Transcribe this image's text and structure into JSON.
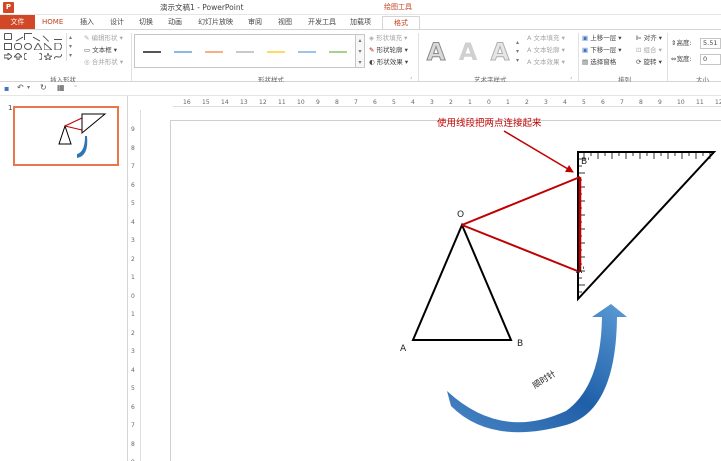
{
  "window": {
    "app_icon": "P",
    "title": "演示文稿1 - PowerPoint",
    "context_tab_group": "绘图工具"
  },
  "tabs": [
    {
      "label": "文件"
    },
    {
      "label": "HOME"
    },
    {
      "label": "插入"
    },
    {
      "label": "设计"
    },
    {
      "label": "切换"
    },
    {
      "label": "动画"
    },
    {
      "label": "幻灯片放映"
    },
    {
      "label": "审阅"
    },
    {
      "label": "视图"
    },
    {
      "label": "开发工具"
    },
    {
      "label": "加载项"
    },
    {
      "label": "格式"
    }
  ],
  "ribbon": {
    "insert_shapes": {
      "label": "插入形状",
      "edit_shape": "编辑形状",
      "text_box": "文本框",
      "merge_shapes": "合并形状"
    },
    "shape_styles": {
      "label": "形状样式",
      "fill": "形状填充",
      "outline": "形状轮廓",
      "effects": "形状效果",
      "swatch_colors": [
        "#555555",
        "#8fb8e0",
        "#f4b183",
        "#c9c9c9",
        "#ffd966",
        "#9dc3e6",
        "#a9d18e"
      ]
    },
    "wordart": {
      "label": "艺术字样式",
      "letter": "A",
      "text_fill": "文本填充",
      "text_outline": "文本轮廓",
      "text_effects": "文本效果"
    },
    "arrange": {
      "label": "排列",
      "bring_forward": "上移一层",
      "send_backward": "下移一层",
      "selection_pane": "选择窗格",
      "align": "对齐",
      "group": "组合",
      "rotate": "旋转"
    },
    "size": {
      "label": "大小",
      "height_label": "高度:",
      "height_value": "5.51",
      "width_label": "宽度:",
      "width_value": "0"
    }
  },
  "thumbnails": [
    {
      "number": "1"
    }
  ],
  "ruler": {
    "h_ticks": [
      "16",
      "15",
      "14",
      "13",
      "12",
      "11",
      "10",
      "9",
      "8",
      "7",
      "6",
      "5",
      "4",
      "3",
      "2",
      "1",
      "0",
      "1",
      "2",
      "3",
      "4",
      "5",
      "6",
      "7",
      "8",
      "9",
      "10",
      "11",
      "12"
    ],
    "v_ticks": [
      "9",
      "8",
      "7",
      "6",
      "5",
      "4",
      "3",
      "2",
      "1",
      "0",
      "1",
      "2",
      "3",
      "4",
      "5",
      "6",
      "7",
      "8",
      "9"
    ]
  },
  "slide": {
    "annotation": "使用线段把两点连接起来",
    "curved_arrow_label": "顺时针",
    "point_labels": {
      "o": "O",
      "a": "A",
      "b": "B",
      "b_prime": "B'",
      "a_prime": "A'"
    },
    "colors": {
      "connector": "#c00000",
      "arrow_fill": "#2e75b6",
      "triangle": "#000000"
    }
  }
}
